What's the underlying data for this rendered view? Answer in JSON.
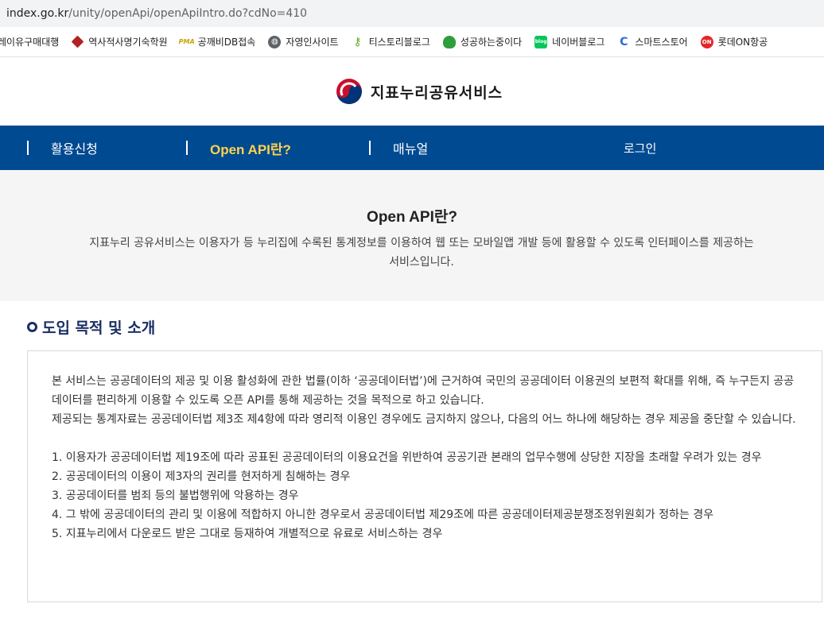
{
  "browser": {
    "url_host": "index.go.kr",
    "url_path": "/unity/openApi/openApiIntro.do?cdNo=410"
  },
  "bookmarks": [
    {
      "label": "레이유구매대행",
      "icon": "none"
    },
    {
      "label": "역사적사명기숙학원",
      "icon": "diamond-icon"
    },
    {
      "label": "공깨비DB접속",
      "icon": "pma-icon"
    },
    {
      "label": "자영인사이트",
      "icon": "globe-icon"
    },
    {
      "label": "티스토리블로그",
      "icon": "key-icon"
    },
    {
      "label": "성공하는중이다",
      "icon": "cup-icon"
    },
    {
      "label": "네이버블로그",
      "icon": "blog-icon"
    },
    {
      "label": "스마트스토어",
      "icon": "c-icon"
    },
    {
      "label": "롯데ON항공",
      "icon": "on-icon"
    }
  ],
  "bookmark_icon_text": {
    "pma": "PMA",
    "blog": "blog",
    "on": "ON",
    "c": "C",
    "key": "⚷",
    "globe": "◍"
  },
  "site": {
    "title": "지표누리공유서비스"
  },
  "nav": {
    "items": [
      {
        "label": "활용신청"
      },
      {
        "label": "Open API란?"
      },
      {
        "label": "매뉴얼"
      }
    ],
    "login": "로그인"
  },
  "intro": {
    "title": "Open API란?",
    "line1": "지표누리 공유서비스는 이용자가 등 누리집에 수록된 통계정보를 이용하여 웹 또는 모바일앱 개발 등에 활용할 수 있도록 인터페이스를 제공하는",
    "line2": "서비스입니다."
  },
  "section": {
    "title": "도입 목적 및 소개",
    "para1": "본 서비스는 공공데이터의 제공 및 이용 활성화에 관한 법률(이하 ‘공공데이터법’)에 근거하여 국민의 공공데이터 이용권의 보편적 확대를 위해, 즉 누구든지 공공데이터를 편리하게 이용할 수 있도록 오픈 API를 통해 제공하는 것을 목적으로 하고 있습니다.",
    "para2": "제공되는 통계자료는 공공데이터법 제3조 제4항에 따라 영리적 이용인 경우에도 금지하지 않으나, 다음의 어느 하나에 해당하는 경우 제공을 중단할 수 있습니다.",
    "items": [
      "1. 이용자가 공공데이터법 제19조에 따라 공표된 공공데이터의 이용요건을 위반하여 공공기관 본래의 업무수행에 상당한 지장을 초래할 우려가 있는 경우",
      "2. 공공데이터의 이용이 제3자의 권리를 현저하게 침해하는 경우",
      "3. 공공데이터를 범죄 등의 불법행위에 악용하는 경우",
      "4. 그 밖에 공공데이터의 관리 및 이용에 적합하지 아니한 경우로서 공공데이터법 제29조에 따른 공공데이터제공분쟁조정위원회가 정하는 경우",
      "5. 지표누리에서 다운로드 받은 그대로 등재하여 개별적으로 유료로 서비스하는 경우"
    ]
  },
  "colors": {
    "nav_bg": "#004a91",
    "nav_active": "#ffd34d",
    "section_title": "#1b2f66",
    "intro_bg": "#f5f5f5"
  }
}
